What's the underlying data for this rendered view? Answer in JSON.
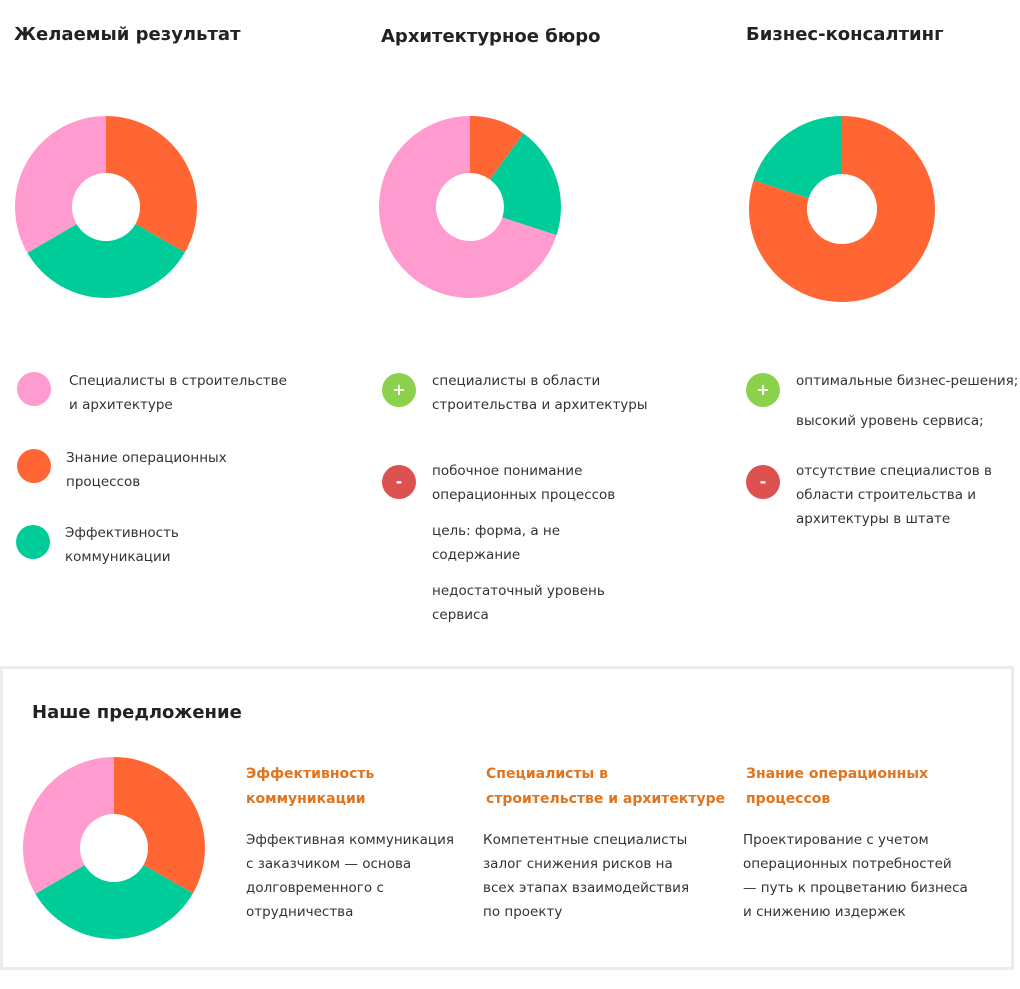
{
  "colors": {
    "pink": "#FF9BCF",
    "orange": "#FF6633",
    "green": "#00CC99",
    "plus": "#8BD14B",
    "minus": "#DE5151",
    "accent": "#E0741F"
  },
  "columns": [
    {
      "title": "Желаемый результат",
      "legend": [
        {
          "text": "Специалисты в строительстве\nи архитектуре",
          "color_key": "pink"
        },
        {
          "text": "Знание операционных\nпроцессов",
          "color_key": "orange"
        },
        {
          "text": "Эффективность\nкоммуникации",
          "color_key": "green"
        }
      ]
    },
    {
      "title": "Архитектурное бюро",
      "plus_sign": "+",
      "minus_sign": "-",
      "pros": [
        "специалисты в области\nстроительства и архитектуры"
      ],
      "cons": [
        "побочное понимание\nоперационных процессов",
        "цель: форма, а не\nсодержание",
        "недостаточный уровень\nсервиса"
      ]
    },
    {
      "title": "Бизнес-консалтинг",
      "plus_sign": "+",
      "minus_sign": "-",
      "pros": [
        "оптимальные бизнес-решения;",
        "высокий уровень сервиса;"
      ],
      "cons": [
        "отсутствие специалистов в\nобласти строительства и\nархитектуры в штате"
      ]
    }
  ],
  "offer": {
    "title": "Наше предложение",
    "items": [
      {
        "title": "Эффективность\nкоммуникации",
        "text": "Эффективная коммуникация\nс заказчиком — основа\nдолговременного с\nотрудничества"
      },
      {
        "title": "Специалисты  в\nстроительстве и архитектуре",
        "text": "Компетентные специалисты\nзалог снижения рисков на\nвсех этапах взаимодействия\nпо проекту"
      },
      {
        "title": "Знание операционных\nпроцессов",
        "text": "Проектирование с учетом\nоперационных потребностей\n— путь к процветанию бизнеса\nи снижению издержек"
      }
    ]
  },
  "chart_data": [
    {
      "type": "pie",
      "donut": true,
      "title": "Желаемый результат",
      "slices": [
        {
          "label": "Знание операционных процессов",
          "value": 33.3,
          "color": "#FF6633"
        },
        {
          "label": "Эффективность коммуникации",
          "value": 33.3,
          "color": "#00CC99"
        },
        {
          "label": "Специалисты в строительстве и архитектуре",
          "value": 33.4,
          "color": "#FF9BCF"
        }
      ]
    },
    {
      "type": "pie",
      "donut": true,
      "title": "Архитектурное бюро",
      "slices": [
        {
          "label": "Знание операционных процессов",
          "value": 10,
          "color": "#FF6633"
        },
        {
          "label": "Эффективность коммуникации",
          "value": 20,
          "color": "#00CC99"
        },
        {
          "label": "Специалисты в строительстве и архитектуре",
          "value": 70,
          "color": "#FF9BCF"
        }
      ]
    },
    {
      "type": "pie",
      "donut": true,
      "title": "Бизнес-консалтинг",
      "slices": [
        {
          "label": "Знание операционных процессов",
          "value": 80,
          "color": "#FF6633"
        },
        {
          "label": "Эффективность коммуникации",
          "value": 20,
          "color": "#00CC99"
        }
      ]
    },
    {
      "type": "pie",
      "donut": true,
      "title": "Наше предложение",
      "slices": [
        {
          "label": "Знание операционных процессов",
          "value": 33.3,
          "color": "#FF6633"
        },
        {
          "label": "Эффективность коммуникации",
          "value": 33.3,
          "color": "#00CC99"
        },
        {
          "label": "Специалисты в строительстве и архитектуре",
          "value": 33.4,
          "color": "#FF9BCF"
        }
      ]
    }
  ]
}
